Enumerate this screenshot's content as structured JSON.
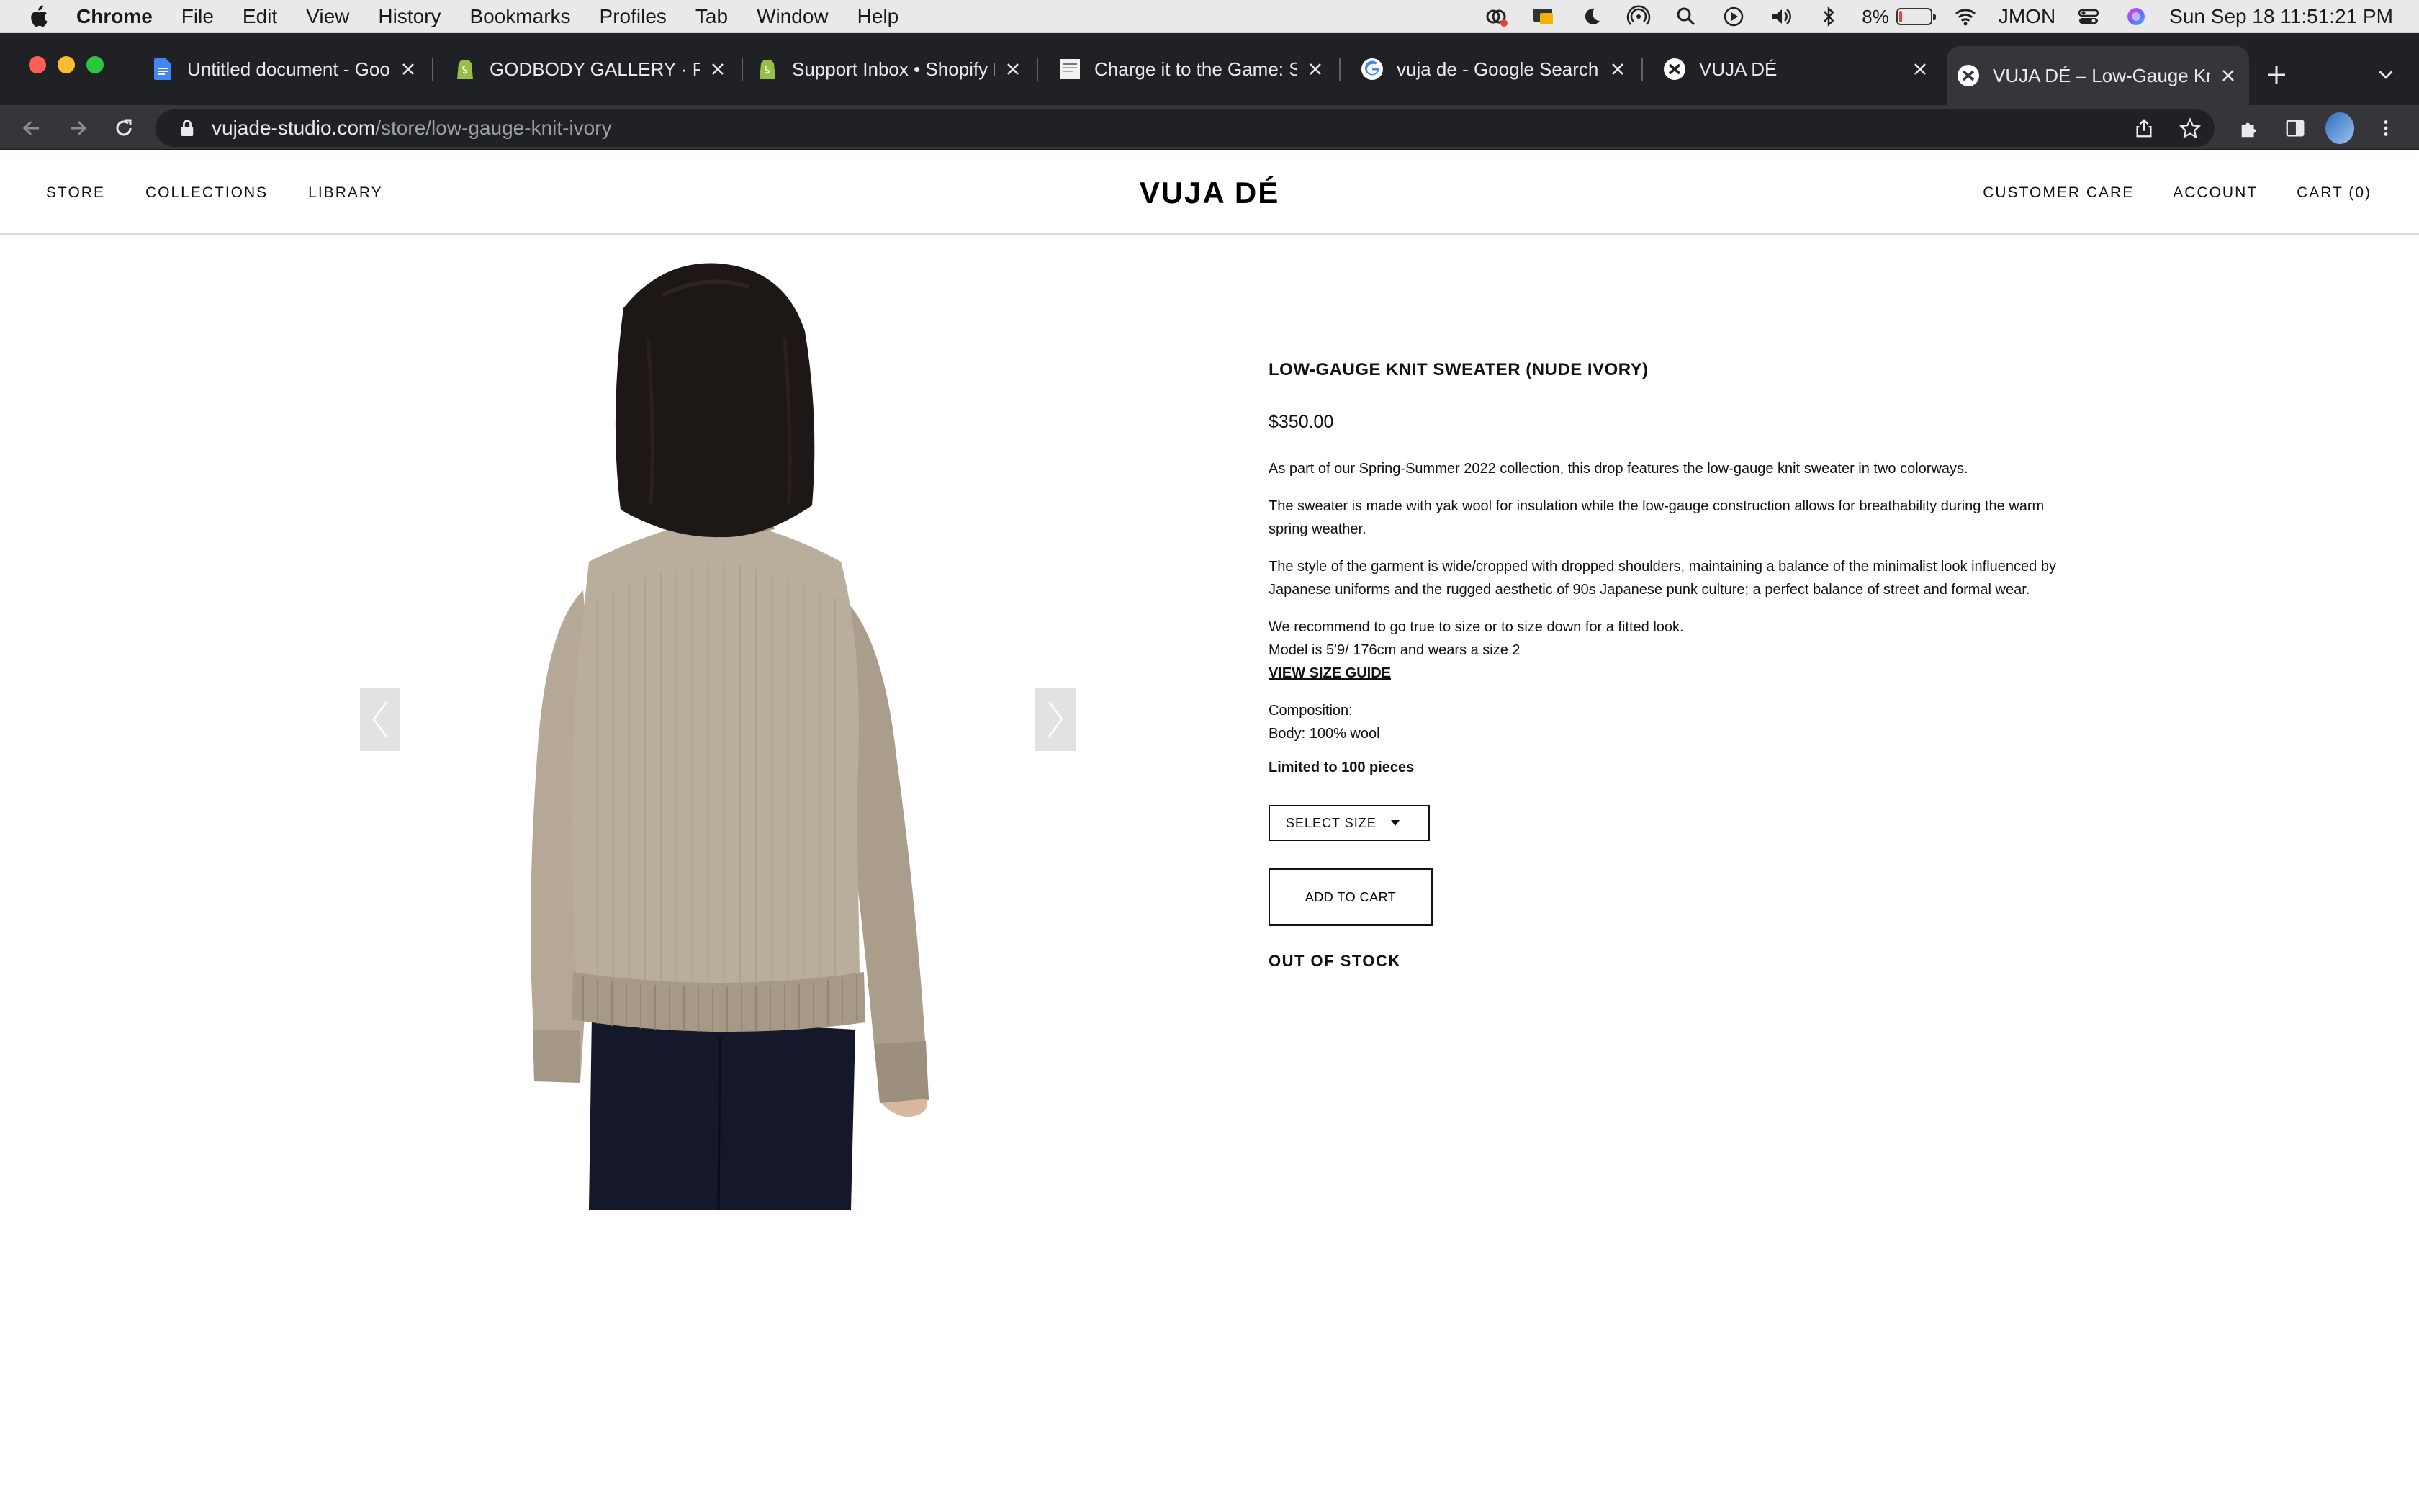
{
  "menubar": {
    "app": "Chrome",
    "items": [
      "File",
      "Edit",
      "View",
      "History",
      "Bookmarks",
      "Profiles",
      "Tab",
      "Window",
      "Help"
    ],
    "battery_percent": "8%",
    "user": "JMON",
    "datetime": "Sun Sep 18  11:51:21 PM",
    "battery_color": "#e0463c"
  },
  "tabs": [
    {
      "title": "Untitled document - Goog",
      "icon": "google-docs-icon"
    },
    {
      "title": "GODBODY GALLERY · Pro",
      "icon": "shopify-icon"
    },
    {
      "title": "Support Inbox • Shopify H",
      "icon": "shopify-icon"
    },
    {
      "title": "Charge it to the Game: So",
      "icon": "page-icon"
    },
    {
      "title": "vuja de - Google Search",
      "icon": "google-icon"
    },
    {
      "title": "VUJA DÉ",
      "icon": "vujade-icon"
    },
    {
      "title": "VUJA DÉ – Low-Gauge Kn",
      "icon": "vujade-icon",
      "active": true
    }
  ],
  "address": {
    "host": "vujade-studio.com",
    "path": "/store/low-gauge-knit-ivory"
  },
  "site": {
    "logo": "VUJA DÉ",
    "nav_left": [
      "STORE",
      "COLLECTIONS",
      "LIBRARY"
    ],
    "nav_right": [
      "CUSTOMER CARE",
      "ACCOUNT",
      "CART (0)"
    ]
  },
  "product": {
    "title": "LOW-GAUGE KNIT SWEATER (NUDE IVORY)",
    "price": "$350.00",
    "desc1": "As part of our Spring-Summer 2022 collection, this drop features the low-gauge knit sweater in two colorways.",
    "desc2": "The sweater is made with yak wool for insulation while the low-gauge construction allows for breathability during the warm spring weather.",
    "desc3": "The style of the garment is wide/cropped with dropped shoulders, maintaining a balance of the minimalist look influenced by Japanese uniforms and the rugged aesthetic of 90s Japanese punk culture; a perfect balance of street and formal wear.",
    "fit_note": "We recommend to go true to size or to size down for a fitted look.",
    "model_note": "Model is 5'9/ 176cm and wears a size 2",
    "size_guide": "VIEW SIZE GUIDE",
    "composition_label": "Composition:",
    "composition_value": "Body: 100% wool",
    "limited": "Limited to 100 pieces",
    "select_size": "SELECT SIZE",
    "add_to_cart": "ADD TO CART",
    "stock_status": "OUT OF STOCK",
    "sweater_color": "#b5a897"
  }
}
